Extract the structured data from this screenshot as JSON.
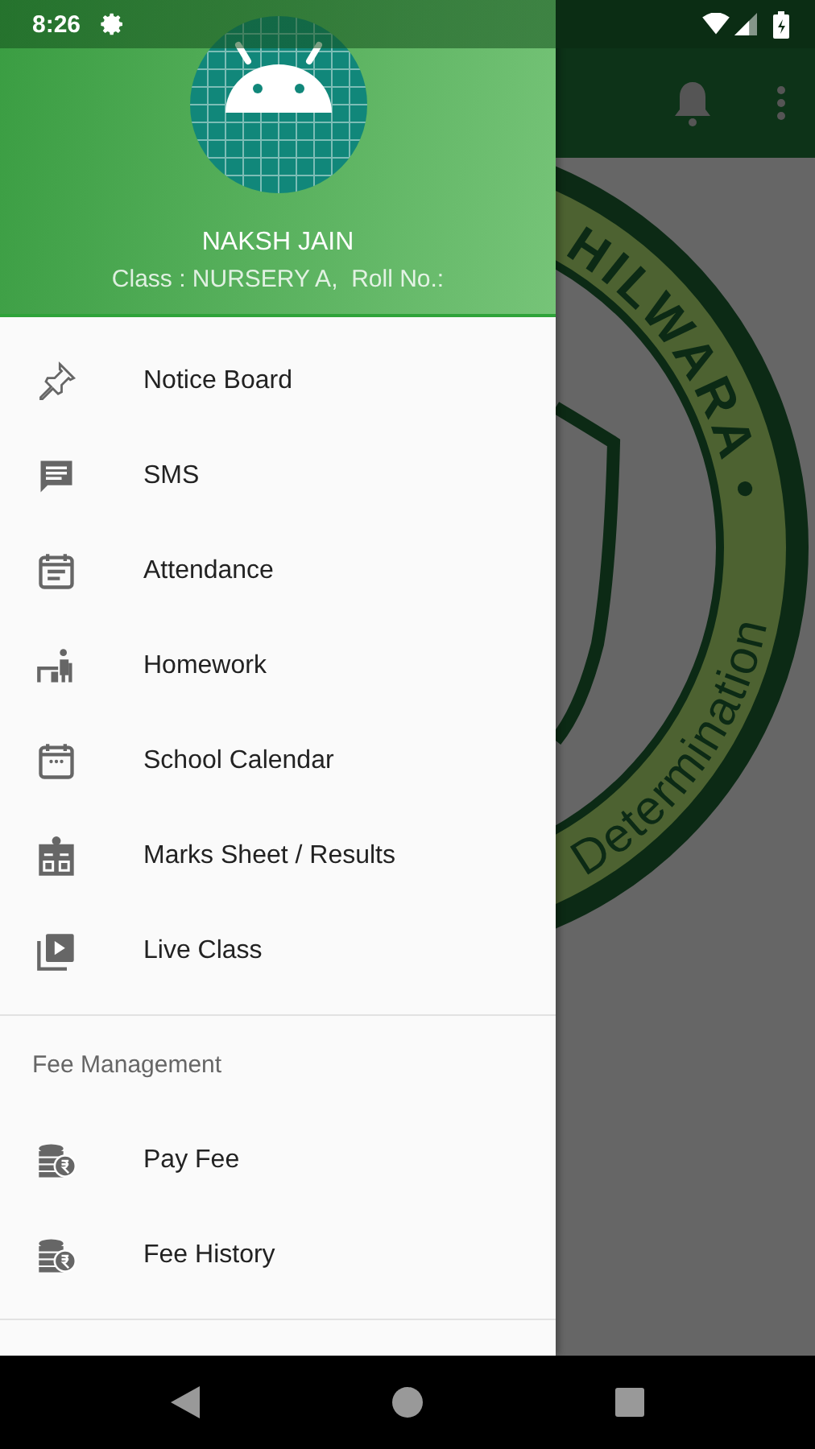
{
  "status_bar": {
    "time": "8:26"
  },
  "drawer": {
    "profile": {
      "name": "NAKSH JAIN",
      "details": "Class : NURSERY A,  Roll No.:"
    },
    "items": [
      {
        "label": "Notice Board",
        "kind": "pin"
      },
      {
        "label": "SMS",
        "kind": "chat"
      },
      {
        "label": "Attendance",
        "kind": "attendance"
      },
      {
        "label": "Homework",
        "kind": "desk"
      },
      {
        "label": "School Calendar",
        "kind": "calendar"
      },
      {
        "label": "Marks Sheet / Results",
        "kind": "clipboard"
      },
      {
        "label": "Live Class",
        "kind": "video"
      }
    ],
    "sections": [
      {
        "title": "Fee Management",
        "items": [
          {
            "label": "Pay Fee",
            "kind": "fee"
          },
          {
            "label": "Fee History",
            "kind": "fee"
          }
        ]
      }
    ]
  },
  "emblem": {
    "ring_texts": [
      "HILWARA •",
      "Determination"
    ]
  }
}
